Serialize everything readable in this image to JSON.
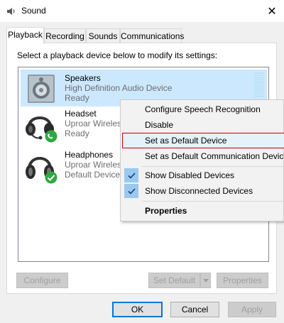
{
  "window": {
    "title": "Sound",
    "close_glyph": "✕"
  },
  "tabs": [
    {
      "label": "Playback",
      "active": true
    },
    {
      "label": "Recording"
    },
    {
      "label": "Sounds"
    },
    {
      "label": "Communications"
    }
  ],
  "instruction": "Select a playback device below to modify its settings:",
  "devices": [
    {
      "name": "Speakers",
      "line1": "High Definition Audio Device",
      "line2": "Ready",
      "icon": "speaker-icon",
      "selected": true
    },
    {
      "name": "Headset",
      "line1": "Uproar Wireless",
      "line2": "Ready",
      "icon": "headset-icon",
      "badge": "phone-badge"
    },
    {
      "name": "Headphones",
      "line1": "Uproar Wireless",
      "line2": "Default Device",
      "icon": "headphones-icon",
      "badge": "default-check-badge"
    }
  ],
  "context_menu": {
    "items": [
      {
        "label": "Configure Speech Recognition"
      },
      {
        "label": "Disable"
      },
      {
        "label": "Set as Default Device",
        "highlighted": true
      },
      {
        "label": "Set as Default Communication Device"
      },
      {
        "label": "Show Disabled Devices",
        "checked": true
      },
      {
        "label": "Show Disconnected Devices",
        "checked": true
      },
      {
        "label": "Properties",
        "bold": true
      }
    ]
  },
  "panel_buttons": {
    "configure": "Configure",
    "set_default": "Set Default",
    "properties": "Properties"
  },
  "dialog_buttons": {
    "ok": "OK",
    "cancel": "Cancel",
    "apply": "Apply"
  },
  "colors": {
    "selection": "#cce8ff",
    "menu_highlight_border": "#cc0000",
    "check_bg": "#99c9ef",
    "badge_green": "#2fa843",
    "accent": "#0078d7"
  }
}
